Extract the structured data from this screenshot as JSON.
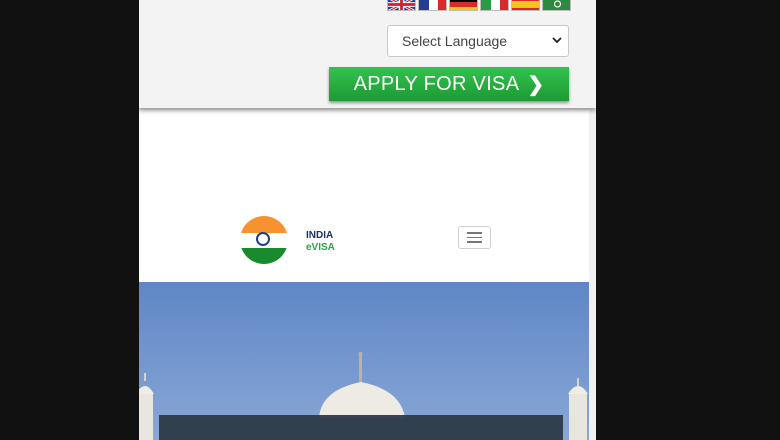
{
  "language": {
    "flags": [
      "United Kingdom",
      "France",
      "Germany",
      "Italy",
      "Spain",
      "Saudi Arabia"
    ],
    "select_label": "Select Language"
  },
  "apply_button": {
    "label": "APPLY FOR VISA",
    "arrow": "❯"
  },
  "brand": {
    "line1": "INDIA",
    "line2": "eVISA"
  },
  "colors": {
    "apply_green": "#2bb142",
    "saffron": "#f7932e",
    "india_green": "#1a8b2c",
    "navy": "#1b2f6e",
    "hero_sky": "#6f95cd"
  }
}
